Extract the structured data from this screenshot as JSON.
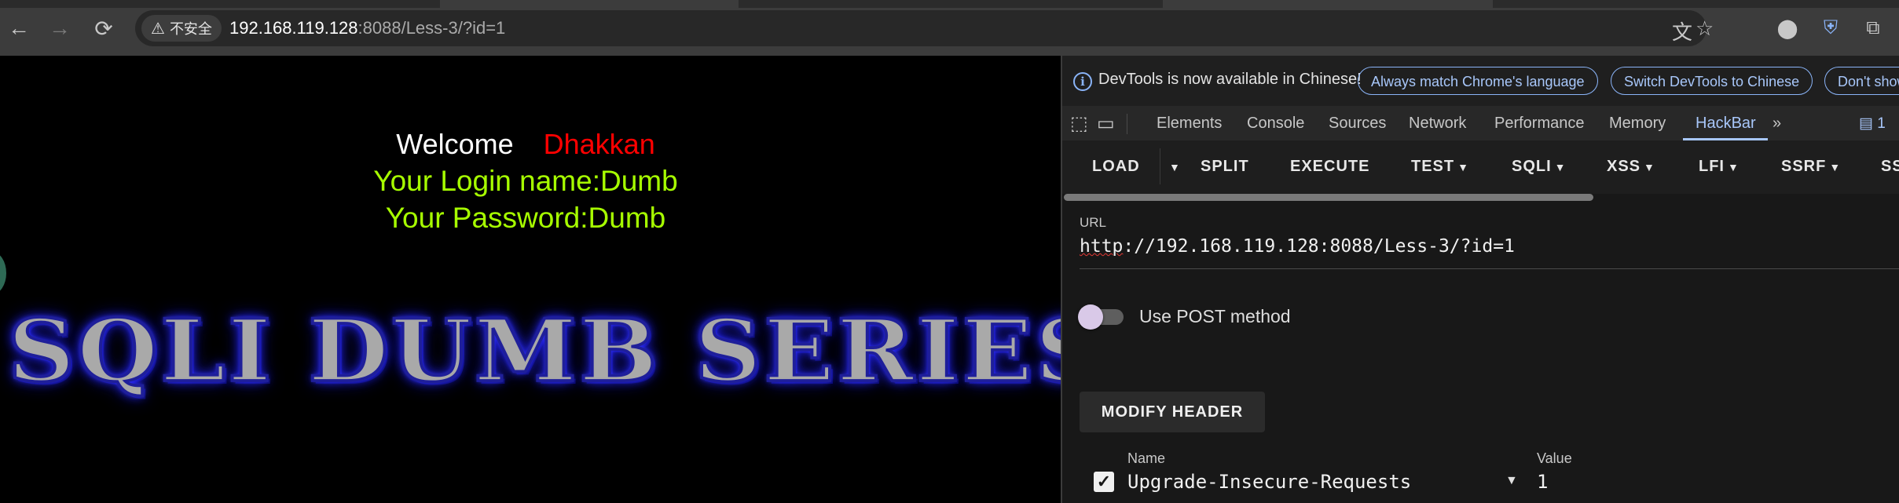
{
  "browser": {
    "nav": {
      "back": "←",
      "forward": "→",
      "reload": "⟳"
    },
    "security_chip": {
      "icon": "warning-icon",
      "label": "不安全"
    },
    "address": {
      "host": "192.168.119.128",
      "rest": ":8088/Less-3/?id=1"
    },
    "omnibox_icons": [
      "translate-icon",
      "bookmark-star-icon"
    ],
    "extension_icons": [
      "record-icon",
      "shield-extension-icon",
      "puzzle-extensions-icon"
    ]
  },
  "page": {
    "welcome": "Welcome",
    "user": "Dhakkan",
    "login_line": "Your Login name:Dumb",
    "password_line": "Your Password:Dumb",
    "banner": "SQLI DUMB SERIES",
    "colors": {
      "welcome": "#ffffff",
      "user": "#ff0000",
      "green": "#a7ff00"
    }
  },
  "devtools": {
    "infobar": {
      "text": "DevTools is now available in Chinese!",
      "buttons": [
        "Always match Chrome's language",
        "Switch DevTools to Chinese",
        "Don't show"
      ]
    },
    "tabs": [
      "Elements",
      "Console",
      "Sources",
      "Network",
      "Performance",
      "Memory",
      "HackBar"
    ],
    "active_tab": "HackBar",
    "more": "»",
    "issues_badge": "1",
    "hackbar": {
      "buttons": [
        "LOAD",
        "SPLIT",
        "EXECUTE",
        "TEST",
        "SQLI",
        "XSS",
        "LFI",
        "SSRF",
        "SS"
      ],
      "url_label": "URL",
      "url_scheme": "http",
      "url_rest": "://192.168.119.128:8088/Less-3/?id=1",
      "post_label": "Use POST method",
      "post_enabled": false,
      "modify_header": "MODIFY HEADER",
      "headers_columns": {
        "name": "Name",
        "value": "Value"
      },
      "header_row": {
        "checked": true,
        "check": "✓",
        "name": "Upgrade-Insecure-Requests",
        "value": "1"
      }
    }
  }
}
